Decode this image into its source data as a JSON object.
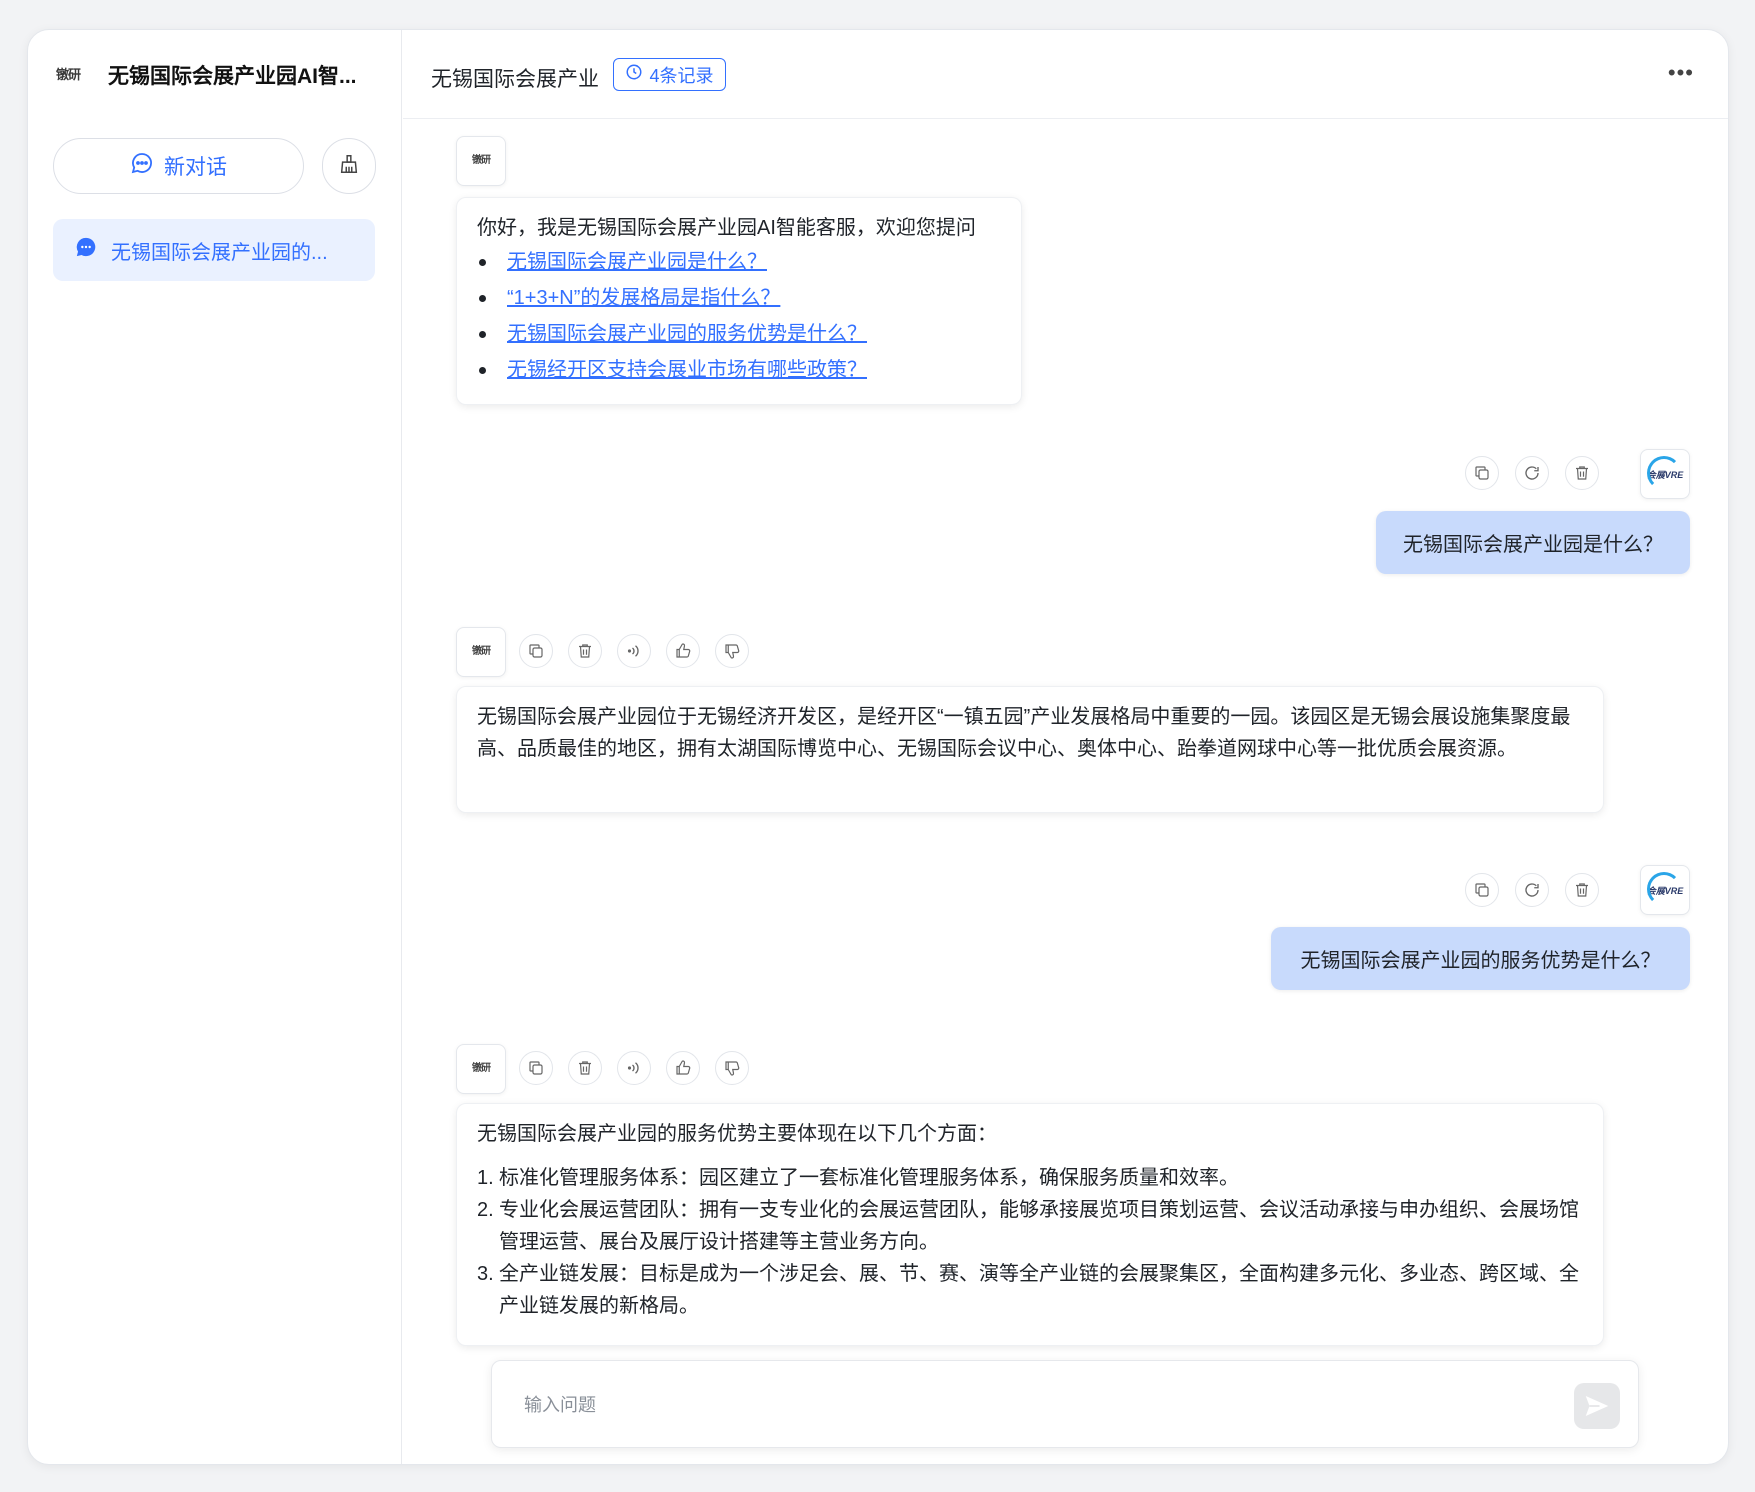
{
  "sidebar": {
    "brand_logo_text": "镦研",
    "brand_title": "无锡国际会展产业园AI智...",
    "new_chat_label": "新对话",
    "history": [
      {
        "label": "无锡国际会展产业园的..."
      }
    ]
  },
  "header": {
    "title": "无锡国际会展产业",
    "record_badge": "4条记录",
    "more_label": "•••"
  },
  "user_avatar_text": "会展VRE",
  "messages": [
    {
      "role": "bot",
      "intro": "你好，我是无锡国际会展产业园AI智能客服，欢迎您提问",
      "suggestions": [
        "无锡国际会展产业园是什么？",
        "“1+3+N”的发展格局是指什么？",
        "无锡国际会展产业园的服务优势是什么？",
        "无锡经开区支持会展业市场有哪些政策？"
      ]
    },
    {
      "role": "user",
      "text": "无锡国际会展产业园是什么？"
    },
    {
      "role": "bot",
      "text": "无锡国际会展产业园位于无锡经济开发区，是经开区“一镇五园”产业发展格局中重要的一园。该园区是无锡会展设施集聚度最高、品质最佳的地区，拥有太湖国际博览中心、无锡国际会议中心、奥体中心、跆拳道网球中心等一批优质会展资源。"
    },
    {
      "role": "user",
      "text": "无锡国际会展产业园的服务优势是什么？"
    },
    {
      "role": "bot",
      "intro": "无锡国际会展产业园的服务优势主要体现在以下几个方面：",
      "items": [
        {
          "num": "1.",
          "text": "标准化管理服务体系：园区建立了一套标准化管理服务体系，确保服务质量和效率。"
        },
        {
          "num": "2.",
          "text": "专业化会展运营团队：拥有一支专业化的会展运营团队，能够承接展览项目策划运营、会议活动承接与申办组织、会展场馆管理运营、展台及展厅设计搭建等主营业务方向。"
        },
        {
          "num": "3.",
          "text": "全产业链发展：目标是成为一个涉足会、展、节、赛、演等全产业链的会展聚集区，全面构建多元化、多业态、跨区域、全产业链发展的新格局。"
        }
      ]
    }
  ],
  "input": {
    "placeholder": "输入问题"
  },
  "colors": {
    "accent": "#3370ff",
    "user_bubble": "#c8dafc",
    "history_bg": "#eaf1ff"
  }
}
